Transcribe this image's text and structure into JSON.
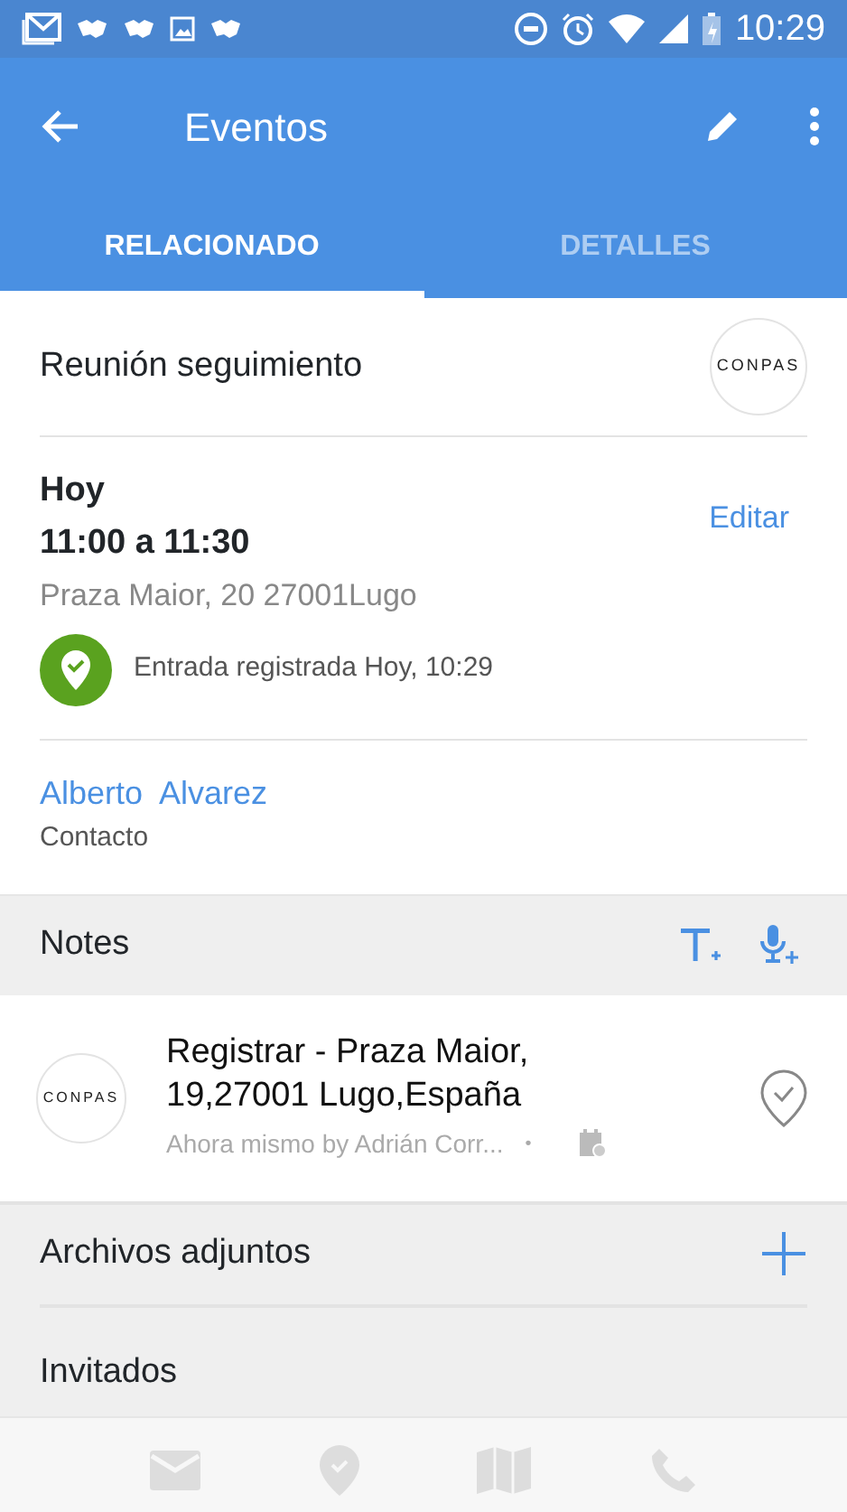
{
  "status_bar": {
    "time": "10:29"
  },
  "app_bar": {
    "title": "Eventos"
  },
  "tabs": [
    {
      "label": "RELACIONADO",
      "selected": true
    },
    {
      "label": "DETALLES",
      "selected": false
    }
  ],
  "event": {
    "title": "Reunión seguimiento",
    "logo": "CONPAS",
    "day": "Hoy",
    "time": "11:00 a 11:30",
    "address": "Praza Maior, 20 27001Lugo",
    "edit": "Editar",
    "checkin": "Entrada registrada Hoy, 10:29",
    "contact_name": "Alberto  Alvarez",
    "contact_role": "Contacto"
  },
  "notes": {
    "title": "Notes",
    "items": [
      {
        "logo": "CONPAS",
        "text": "Registrar - Praza Maior, 19,27001 Lugo,España",
        "meta": "Ahora mismo by Adrián Corr...",
        "separator": "•"
      }
    ]
  },
  "sections": [
    {
      "title": "Archivos adjuntos",
      "add": true
    },
    {
      "title": "Invitados",
      "add": false
    }
  ]
}
